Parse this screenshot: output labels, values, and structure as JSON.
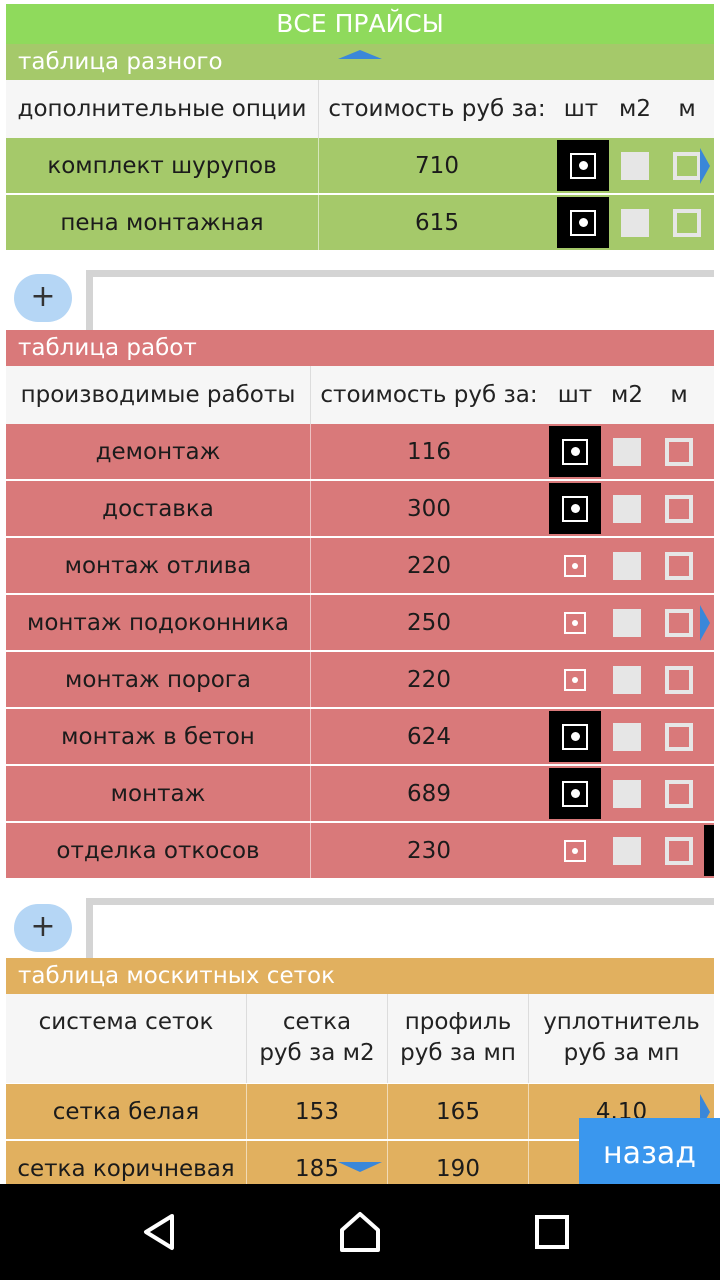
{
  "topbar": {
    "all_prices_label": "ВСЕ ПРАЙСЫ"
  },
  "misc_table": {
    "title": "таблица разного",
    "headers": {
      "name": "дополнительные опции",
      "price": "стоимость руб за:",
      "unit_pcs": "шт",
      "unit_m2": "м2",
      "unit_m": "м"
    },
    "rows": [
      {
        "name": "комплект шурупов",
        "price": "710",
        "unit": "шт"
      },
      {
        "name": "пена монтажная",
        "price": "615",
        "unit": "шт"
      }
    ],
    "add_label": "+"
  },
  "works_table": {
    "title": "таблица работ",
    "headers": {
      "name": "производимые работы",
      "price": "стоимость руб за:",
      "unit_pcs": "шт",
      "unit_m2": "м2",
      "unit_m": "м"
    },
    "rows": [
      {
        "name": "демонтаж",
        "price": "116",
        "unit": "шт",
        "selected": true
      },
      {
        "name": "доставка",
        "price": "300",
        "unit": "шт",
        "selected": true
      },
      {
        "name": "монтаж отлива",
        "price": "220",
        "unit": "шт",
        "selected": false
      },
      {
        "name": "монтаж подоконника",
        "price": "250",
        "unit": "шт",
        "selected": false
      },
      {
        "name": "монтаж порога",
        "price": "220",
        "unit": "шт",
        "selected": false
      },
      {
        "name": "монтаж в бетон",
        "price": "624",
        "unit": "шт",
        "selected": true
      },
      {
        "name": "монтаж",
        "price": "689",
        "unit": "шт",
        "selected": true
      },
      {
        "name": "отделка откосов",
        "price": "230",
        "unit": "шт",
        "selected": false
      }
    ],
    "add_label": "+"
  },
  "mosquito_table": {
    "title": "таблица москитных сеток",
    "headers": {
      "system": "система сеток",
      "mesh": [
        "сетка",
        "руб за м2"
      ],
      "profile": [
        "профиль",
        "руб за мп"
      ],
      "seal": [
        "уплотнитель",
        "руб за мп"
      ]
    },
    "rows": [
      {
        "name": "сетка белая",
        "mesh": "153",
        "profile": "165",
        "seal": "4.10"
      },
      {
        "name": "сетка коричневая",
        "mesh": "185",
        "profile": "190",
        "seal": ""
      }
    ]
  },
  "back_button": "назад",
  "colors": {
    "green": "#a5c96a",
    "red": "#d9797a",
    "orange": "#e1b05f",
    "topbar": "#8fda5c",
    "accent": "#3a97ee"
  }
}
